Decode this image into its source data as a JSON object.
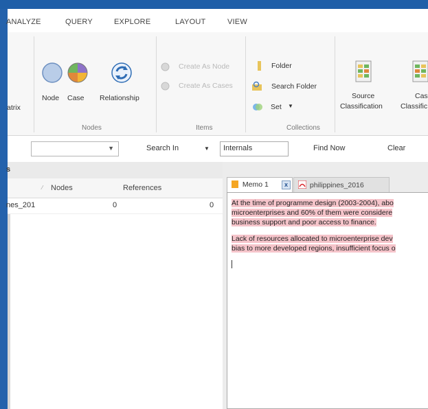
{
  "menu": [
    "ANALYZE",
    "QUERY",
    "EXPLORE",
    "LAYOUT",
    "VIEW"
  ],
  "ribbon": {
    "matrix_label": "atrix",
    "nodes_group": {
      "label": "Nodes",
      "buttons": [
        "Node",
        "Case",
        "Relationship"
      ]
    },
    "items_group": {
      "label": "Items",
      "create_as_node": "Create As Node",
      "create_as_cases": "Create As Cases"
    },
    "collections_group": {
      "label": "Collections",
      "folder": "Folder",
      "search_folder": "Search Folder",
      "set": "Set"
    },
    "classifications": {
      "source_line1": "Source",
      "source_line2": "Classification",
      "case_line1": "Cas",
      "case_line2": "Classific"
    }
  },
  "findbar": {
    "search_in_label": "Search In",
    "search_in_value": "Internals",
    "find_now": "Find Now",
    "clear": "Clear"
  },
  "left_panel": {
    "header": "s",
    "columns": {
      "nodes": "Nodes",
      "references": "References"
    },
    "rows": [
      {
        "name": "nes_201",
        "nodes": "0",
        "references": "0"
      }
    ]
  },
  "tabs": {
    "memo": "Memo 1",
    "pdf": "philippines_2016"
  },
  "editor": {
    "paragraph1": [
      "At the time of programme design (2003-2004), abo",
      "microenterprises and 60% of them were considere",
      "business support and poor access to finance."
    ],
    "paragraph2": [
      "Lack of resources allocated to microenterprise dev",
      "bias to more developed regions, insufficient focus o"
    ]
  },
  "colors": {
    "title_bar": "#1f5fa8",
    "highlight": "#f5c4ca",
    "pdf_icon": "#d9262c",
    "memo_icon": "#f5a623"
  }
}
